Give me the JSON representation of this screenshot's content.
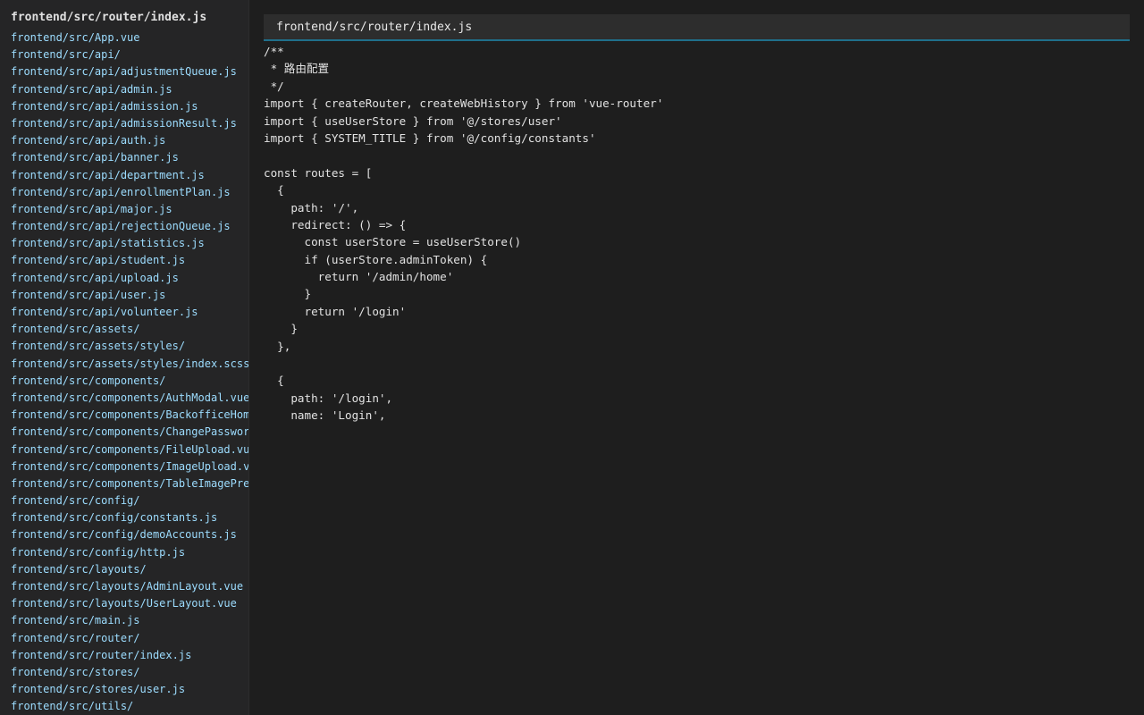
{
  "sidebar": {
    "title": "frontend/src/router/index.js",
    "files": [
      "frontend/src/App.vue",
      "frontend/src/api/",
      "frontend/src/api/adjustmentQueue.js",
      "frontend/src/api/admin.js",
      "frontend/src/api/admission.js",
      "frontend/src/api/admissionResult.js",
      "frontend/src/api/auth.js",
      "frontend/src/api/banner.js",
      "frontend/src/api/department.js",
      "frontend/src/api/enrollmentPlan.js",
      "frontend/src/api/major.js",
      "frontend/src/api/rejectionQueue.js",
      "frontend/src/api/statistics.js",
      "frontend/src/api/student.js",
      "frontend/src/api/upload.js",
      "frontend/src/api/user.js",
      "frontend/src/api/volunteer.js",
      "frontend/src/assets/",
      "frontend/src/assets/styles/",
      "frontend/src/assets/styles/index.scss",
      "frontend/src/components/",
      "frontend/src/components/AuthModal.vue",
      "frontend/src/components/BackofficeHom",
      "frontend/src/components/ChangePasswor",
      "frontend/src/components/FileUpload.vu",
      "frontend/src/components/ImageUpload.v",
      "frontend/src/components/TableImagePre",
      "frontend/src/config/",
      "frontend/src/config/constants.js",
      "frontend/src/config/demoAccounts.js",
      "frontend/src/config/http.js",
      "frontend/src/layouts/",
      "frontend/src/layouts/AdminLayout.vue",
      "frontend/src/layouts/UserLayout.vue",
      "frontend/src/main.js",
      "frontend/src/router/",
      "frontend/src/router/index.js",
      "frontend/src/stores/",
      "frontend/src/stores/user.js",
      "frontend/src/utils/"
    ]
  },
  "editor": {
    "filename": "frontend/src/router/index.js",
    "lines": [
      "/**",
      " * 路由配置",
      " */",
      "import { createRouter, createWebHistory } from 'vue-router'",
      "import { useUserStore } from '@/stores/user'",
      "import { SYSTEM_TITLE } from '@/config/constants'",
      "",
      "const routes = [",
      "  {",
      "    path: '/',",
      "    redirect: () => {",
      "      const userStore = useUserStore()",
      "      if (userStore.adminToken) {",
      "        return '/admin/home'",
      "      }",
      "      return '/login'",
      "    }",
      "  },",
      "",
      "  {",
      "    path: '/login',",
      "    name: 'Login',"
    ]
  }
}
